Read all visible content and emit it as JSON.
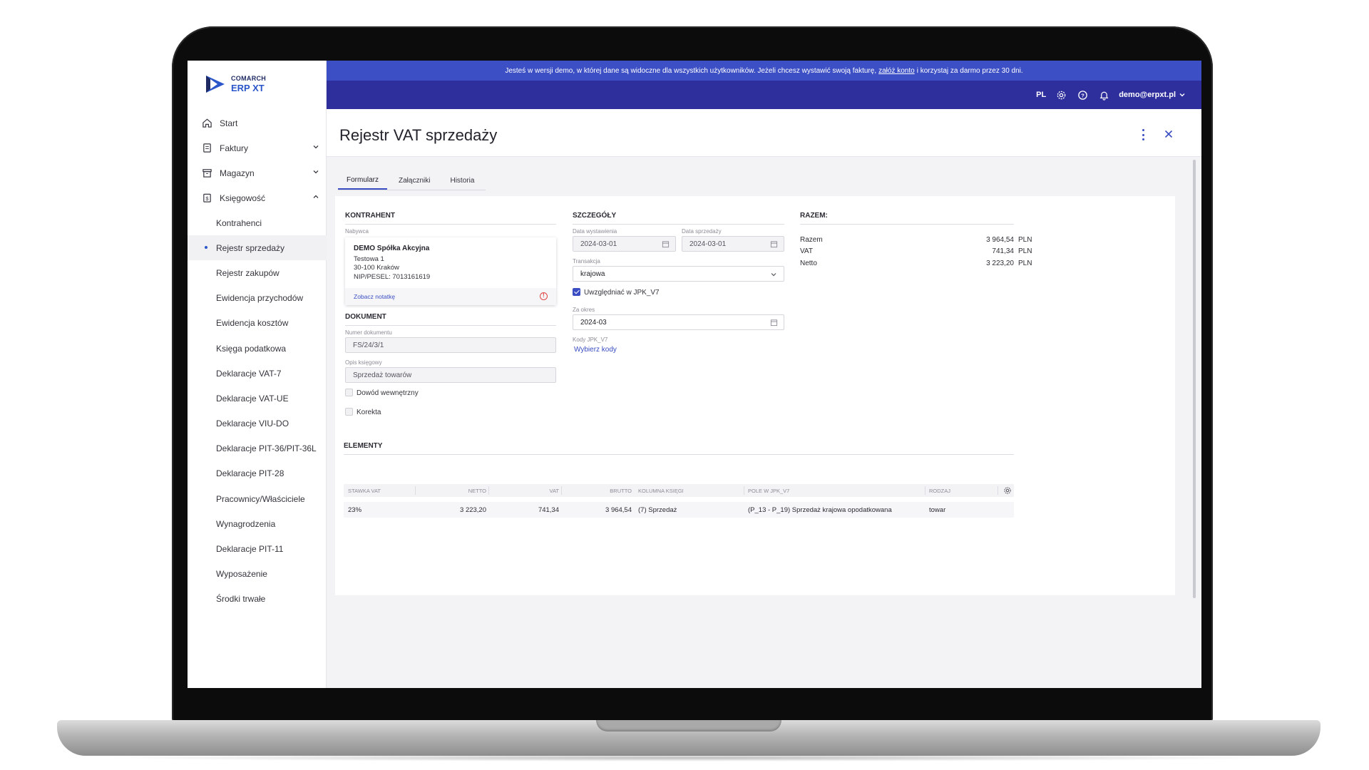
{
  "logo": {
    "brand": "COMARCH",
    "product": "ERP XT"
  },
  "sidebar": {
    "items": [
      {
        "label": "Start",
        "icon": "home-icon"
      },
      {
        "label": "Faktury",
        "icon": "invoice-icon"
      },
      {
        "label": "Magazyn",
        "icon": "warehouse-icon"
      },
      {
        "label": "Księgowość",
        "icon": "accounting-icon"
      }
    ],
    "sub_items": [
      "Kontrahenci",
      "Rejestr sprzedaży",
      "Rejestr zakupów",
      "Ewidencja przychodów",
      "Ewidencja kosztów",
      "Księga podatkowa",
      "Deklaracje VAT-7",
      "Deklaracje VAT-UE",
      "Deklaracje VIU-DO",
      "Deklaracje PIT-36/PIT-36L",
      "Deklaracje PIT-28",
      "Pracownicy/Właściciele",
      "Wynagrodzenia",
      "Deklaracje PIT-11",
      "Wyposażenie",
      "Środki trwałe"
    ],
    "active_sub": "Rejestr sprzedaży"
  },
  "banner": {
    "text_before": "Jesteś w wersji demo, w której dane są widoczne dla wszystkich użytkowników. Jeżeli chcesz wystawić swoją fakturę,",
    "link": "załóż konto",
    "text_after": "i korzystaj za darmo przez 30 dni."
  },
  "topbar": {
    "lang": "PL",
    "user": "demo@erpxt.pl"
  },
  "page": {
    "title": "Rejestr VAT sprzedaży"
  },
  "tabs": [
    "Formularz",
    "Załączniki",
    "Historia"
  ],
  "kontrahent": {
    "section": "KONTRAHENT",
    "label": "Nabywca",
    "name": "DEMO Spółka Akcyjna",
    "street": "Testowa 1",
    "city": "30-100 Kraków",
    "nip": "NIP/PESEL: 7013161619",
    "note_link": "Zobacz notatkę"
  },
  "dokument": {
    "section": "DOKUMENT",
    "number_label": "Numer dokumentu",
    "number_value": "FS/24/3/1",
    "desc_label": "Opis księgowy",
    "desc_value": "Sprzedaż towarów",
    "internal_label": "Dowód wewnętrzny",
    "correction_label": "Korekta"
  },
  "szczegoly": {
    "section": "SZCZEGÓŁY",
    "issue_label": "Data wystawienia",
    "issue_value": "2024-03-01",
    "sale_label": "Data sprzedaży",
    "sale_value": "2024-03-01",
    "trans_label": "Transakcja",
    "trans_value": "krajowa",
    "jpk_label": "Uwzględniać w JPK_V7",
    "period_label": "Za okres",
    "period_value": "2024-03",
    "codes_label": "Kody JPK_V7",
    "codes_link": "Wybierz kody"
  },
  "razem": {
    "section": "RAZEM:",
    "rows": [
      {
        "label": "Razem",
        "value": "3 964,54",
        "currency": "PLN"
      },
      {
        "label": "VAT",
        "value": "741,34",
        "currency": "PLN"
      },
      {
        "label": "Netto",
        "value": "3 223,20",
        "currency": "PLN"
      }
    ]
  },
  "elementy": {
    "section": "ELEMENTY",
    "headers": [
      "STAWKA VAT",
      "NETTO",
      "VAT",
      "BRUTTO",
      "KOLUMNA KSIĘGI",
      "POLE W JPK_V7",
      "RODZAJ"
    ],
    "row": [
      "23%",
      "3 223,20",
      "741,34",
      "3 964,54",
      "(7) Sprzedaż",
      "(P_13 - P_19) Sprzedaż krajowa opodatkowana",
      "towar"
    ]
  },
  "colors": {
    "accent": "#3a4dc2",
    "banner": "#3c4fc5",
    "topbar": "#2e2f9c"
  }
}
